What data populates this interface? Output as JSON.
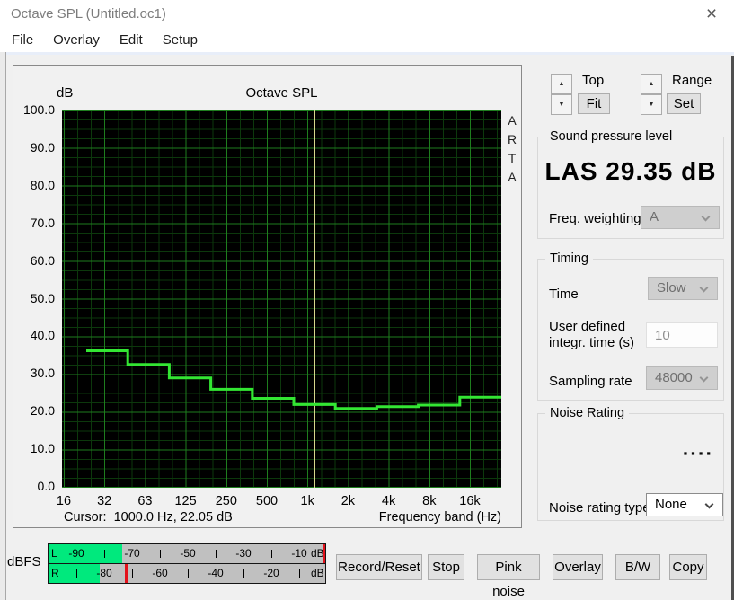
{
  "window": {
    "title": "Octave SPL (Untitled.oc1)",
    "close_glyph": "×"
  },
  "menu": {
    "items": [
      "File",
      "Overlay",
      "Edit",
      "Setup"
    ]
  },
  "chart_data": {
    "type": "step",
    "title": "Octave SPL",
    "ylabel": "dB",
    "xlabel": "Frequency band (Hz)",
    "ylim": [
      0,
      100
    ],
    "ytick_step": 10,
    "grid": "on",
    "categories": [
      "16",
      "32",
      "63",
      "125",
      "250",
      "500",
      "1k",
      "2k",
      "4k",
      "8k",
      "16k"
    ],
    "values": [
      null,
      36.3,
      32.7,
      29.1,
      26.1,
      23.7,
      22.05,
      21.0,
      21.5,
      21.9,
      24.0
    ],
    "cursor": {
      "readout": "Cursor:  1000.0 Hz, 22.05 dB",
      "freq_hz": 1000.0,
      "value_db": 22.05,
      "band_index": 6
    },
    "watermark": "ARTA",
    "colors": {
      "plot_bg": "#000000",
      "grid_minor": "#0c380c",
      "grid_major": "#1e7d1e",
      "curve": "#33e633",
      "cursor_line": "#d6d68c"
    }
  },
  "side_panel": {
    "top_label": "Top",
    "fit_button": "Fit",
    "range_label": "Range",
    "set_button": "Set",
    "spin_up": "▲",
    "spin_down": "▼",
    "spl_group": {
      "title": "Sound pressure level",
      "value": "LAS 29.35 dB",
      "freq_weighting_label": "Freq. weighting",
      "freq_weighting_value": "A"
    },
    "timing_group": {
      "title": "Timing",
      "time_label": "Time",
      "time_value": "Slow",
      "integr_label_line1": "User defined",
      "integr_label_line2": "integr. time (s)",
      "integr_value": "10",
      "sampling_label": "Sampling rate",
      "sampling_value": "48000"
    },
    "noise_group": {
      "title": "Noise Rating",
      "value_dots": "▪▪▪▪",
      "type_label": "Noise rating type",
      "type_value": "None"
    }
  },
  "meter": {
    "label": "dBFS",
    "unit": "dB",
    "range_db": [
      -100,
      0
    ],
    "colors": {
      "bar": "#00e97d",
      "bg": "#c0c0c0",
      "peak": "#e3111b"
    },
    "rows": [
      {
        "channel": "L",
        "bar_db": -73.5,
        "peak_db": -1.5,
        "labels": [
          -90,
          -70,
          -50,
          -30,
          -10
        ],
        "ticks": [
          -80,
          -60,
          -40,
          -20
        ]
      },
      {
        "channel": "R",
        "bar_db": -81.5,
        "peak_db": -72.5,
        "labels": [
          -80,
          -60,
          -40,
          -20
        ],
        "ticks": [
          -90,
          -70,
          -50,
          -30,
          -10
        ]
      }
    ]
  },
  "buttons": [
    "Record/Reset",
    "Stop",
    "Pink noise",
    "Overlay",
    "B/W",
    "Copy"
  ]
}
